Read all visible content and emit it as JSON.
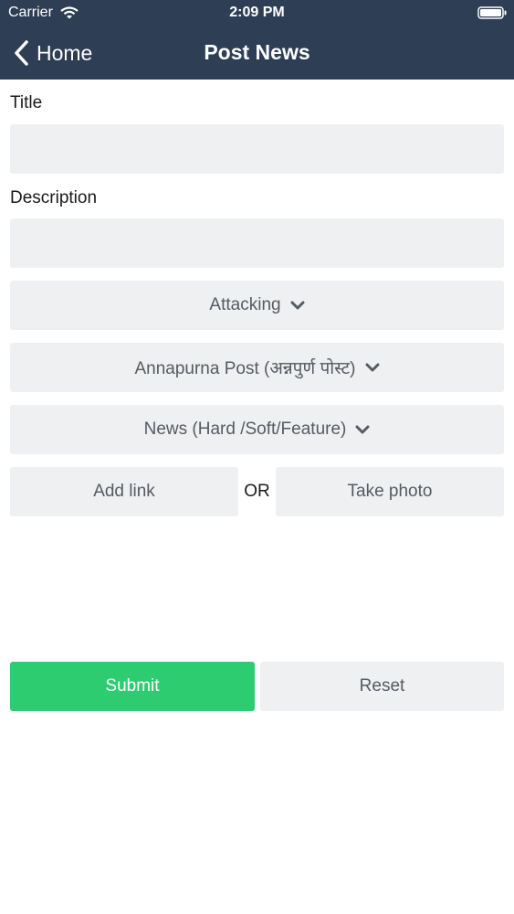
{
  "status_bar": {
    "carrier": "Carrier",
    "time": "2:09 PM"
  },
  "nav": {
    "back_label": "Home",
    "title": "Post News"
  },
  "form": {
    "title_label": "Title",
    "title_value": "",
    "description_label": "Description",
    "description_value": "",
    "category_selected": "Attacking",
    "publication_selected": "Annapurna Post (अन्नपुर्ण पोस्ट)",
    "news_type_selected": "News (Hard /Soft/Feature)",
    "add_link_label": "Add link",
    "or_label": "OR",
    "take_photo_label": "Take photo",
    "submit_label": "Submit",
    "reset_label": "Reset"
  },
  "colors": {
    "nav_background": "#2d3e55",
    "field_background": "#eff0f1",
    "submit_green": "#2ecc71"
  },
  "icons": [
    "wifi-icon",
    "battery-icon",
    "back-chevron-icon",
    "chevron-down-icon"
  ]
}
